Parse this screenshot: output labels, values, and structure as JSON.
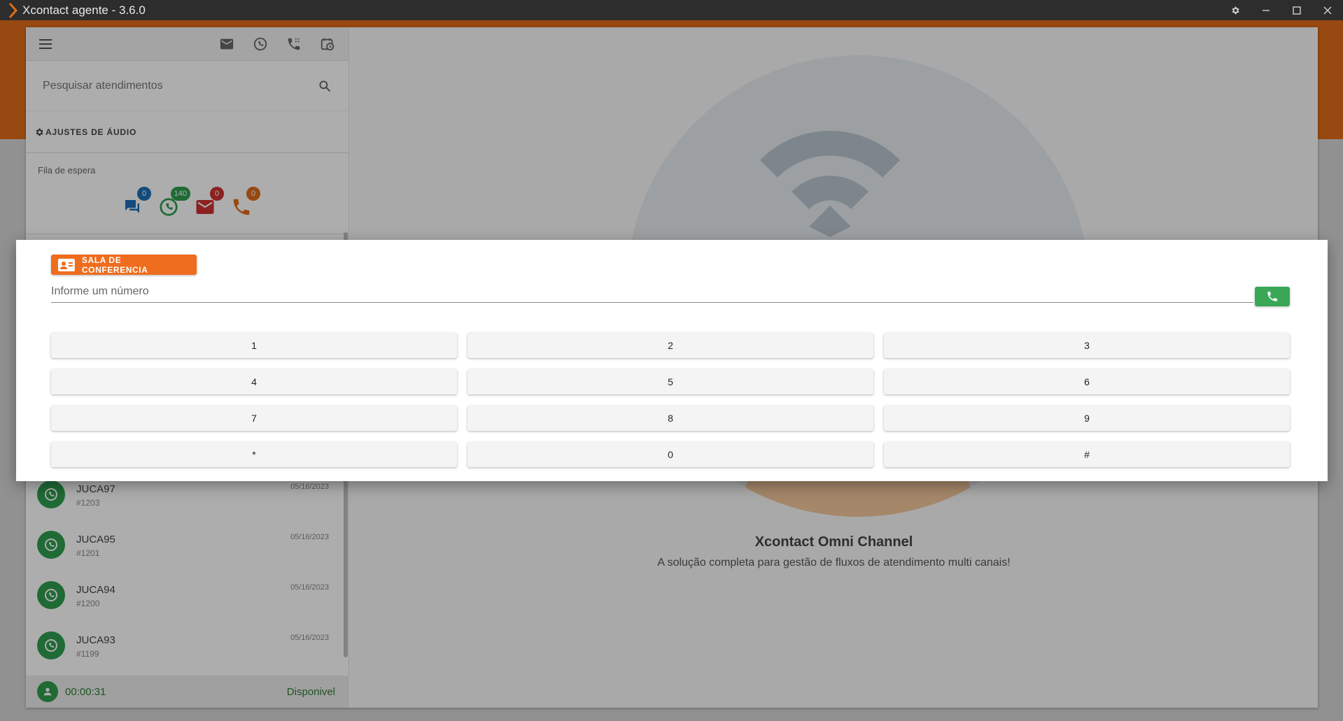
{
  "window": {
    "title": "Xcontact agente - 3.6.0"
  },
  "sidebar": {
    "search_placeholder": "Pesquisar atendimentos",
    "audio_settings_label": "AJUSTES DE ÁUDIO",
    "queue": {
      "label": "Fila de espera",
      "items": [
        {
          "icon": "chat-icon",
          "count": "0",
          "color": "#1e6fb8"
        },
        {
          "icon": "whatsapp-icon",
          "count": "140",
          "color": "#2e9d4f"
        },
        {
          "icon": "email-icon",
          "count": "0",
          "color": "#d03030"
        },
        {
          "icon": "phone-icon",
          "count": "0",
          "color": "#e06a1a"
        }
      ]
    },
    "conversations": [
      {
        "name": "JUCA97",
        "id": "#1203",
        "date": "05/16/2023"
      },
      {
        "name": "JUCA95",
        "id": "#1201",
        "date": "05/16/2023"
      },
      {
        "name": "JUCA94",
        "id": "#1200",
        "date": "05/16/2023"
      },
      {
        "name": "JUCA93",
        "id": "#1199",
        "date": "05/16/2023"
      }
    ],
    "status": {
      "timer": "00:00:31",
      "state": "Disponivel"
    }
  },
  "main": {
    "brand_title": "Xcontact Omni Channel",
    "brand_subtitle": "A solução completa para gestão de fluxos de atendimento multi canais!"
  },
  "dialog": {
    "chip_label": "SALA DE CONFERENCIA",
    "number_placeholder": "Informe um número",
    "keys": [
      "1",
      "2",
      "3",
      "4",
      "5",
      "6",
      "7",
      "8",
      "9",
      "*",
      "0",
      "#"
    ]
  },
  "colors": {
    "accent": "#e06a1a",
    "whatsapp": "#2e9d4f",
    "call_button": "#3aa757"
  }
}
